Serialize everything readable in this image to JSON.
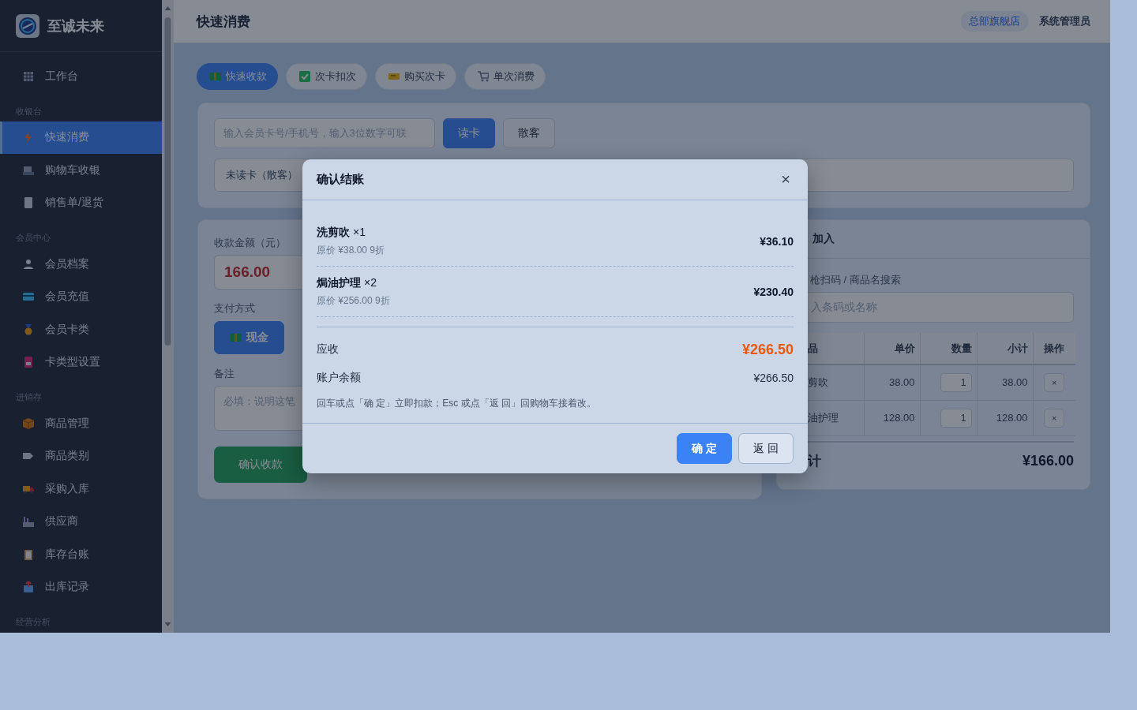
{
  "sidebar": {
    "brand": "至诚未来",
    "items": [
      {
        "kind": "item",
        "label": "工作台",
        "selected": false
      },
      {
        "kind": "section",
        "label": "收银台"
      },
      {
        "kind": "item",
        "label": "快速消费",
        "selected": true
      },
      {
        "kind": "item",
        "label": "购物车收银",
        "selected": false
      },
      {
        "kind": "item",
        "label": "销售单/退货",
        "selected": false
      },
      {
        "kind": "section",
        "label": "会员中心"
      },
      {
        "kind": "item",
        "label": "会员档案",
        "selected": false
      },
      {
        "kind": "item",
        "label": "会员充值",
        "selected": false
      },
      {
        "kind": "item",
        "label": "会员卡类",
        "selected": false
      },
      {
        "kind": "item",
        "label": "卡类型设置",
        "selected": false
      },
      {
        "kind": "section",
        "label": "进销存"
      },
      {
        "kind": "item",
        "label": "商品管理",
        "selected": false
      },
      {
        "kind": "item",
        "label": "商品类别",
        "selected": false
      },
      {
        "kind": "item",
        "label": "采购入库",
        "selected": false
      },
      {
        "kind": "item",
        "label": "供应商",
        "selected": false
      },
      {
        "kind": "item",
        "label": "库存台账",
        "selected": false
      },
      {
        "kind": "item",
        "label": "出库记录",
        "selected": false
      },
      {
        "kind": "section",
        "label": "经营分析"
      }
    ]
  },
  "header": {
    "title": "快速消费",
    "store": "总部旗舰店",
    "user": "系统管理员"
  },
  "mode_tabs": [
    {
      "label": "快速收款",
      "selected": true
    },
    {
      "label": "次卡扣次",
      "selected": false
    },
    {
      "label": "购买次卡",
      "selected": false
    },
    {
      "label": "单次消费",
      "selected": false
    }
  ],
  "member_lookup": {
    "placeholder": "输入会员卡号/手机号，输入3位数字可联",
    "read_button": "读卡",
    "walk_in_button": "散客",
    "card_status": "未读卡（散客）"
  },
  "payment": {
    "amount_label": "收款金额（元）",
    "amount": "166.00",
    "method_label": "支付方式",
    "methods": [
      {
        "label": "现金",
        "selected": true
      }
    ],
    "note_label": "备注",
    "note_placeholder": "必填：说明这笔",
    "submit": "确认收款"
  },
  "cart": {
    "title": "加入",
    "search_label": "枪扫码 / 商品名搜索",
    "search_placeholder": "入条码或名称",
    "columns": [
      "品",
      "单价",
      "数量",
      "小计",
      "操作"
    ],
    "rows": [
      {
        "name": "剪吹",
        "price": "38.00",
        "qty": "1",
        "subtotal": "38.00",
        "remove": "×"
      },
      {
        "name": "油护理",
        "price": "128.00",
        "qty": "1",
        "subtotal": "128.00",
        "remove": "×"
      }
    ],
    "total_label": "计",
    "total": "¥166.00"
  },
  "dialog": {
    "title": "确认结账",
    "close": "×",
    "items": [
      {
        "name": "洗剪吹",
        "qty": "×1",
        "detail": "原价 ¥38.00 9折",
        "amount": "¥36.10"
      },
      {
        "name": "焗油护理",
        "qty": "×2",
        "detail": "原价 ¥256.00 9折",
        "amount": "¥230.40"
      }
    ],
    "due_label": "应收",
    "due": "¥266.50",
    "balance_label": "账户余额",
    "balance": "¥266.50",
    "hint": "回车或点「确 定」立即扣款；Esc 或点「返 回」回购物车接着改。",
    "confirm": "确 定",
    "back": "返 回"
  }
}
